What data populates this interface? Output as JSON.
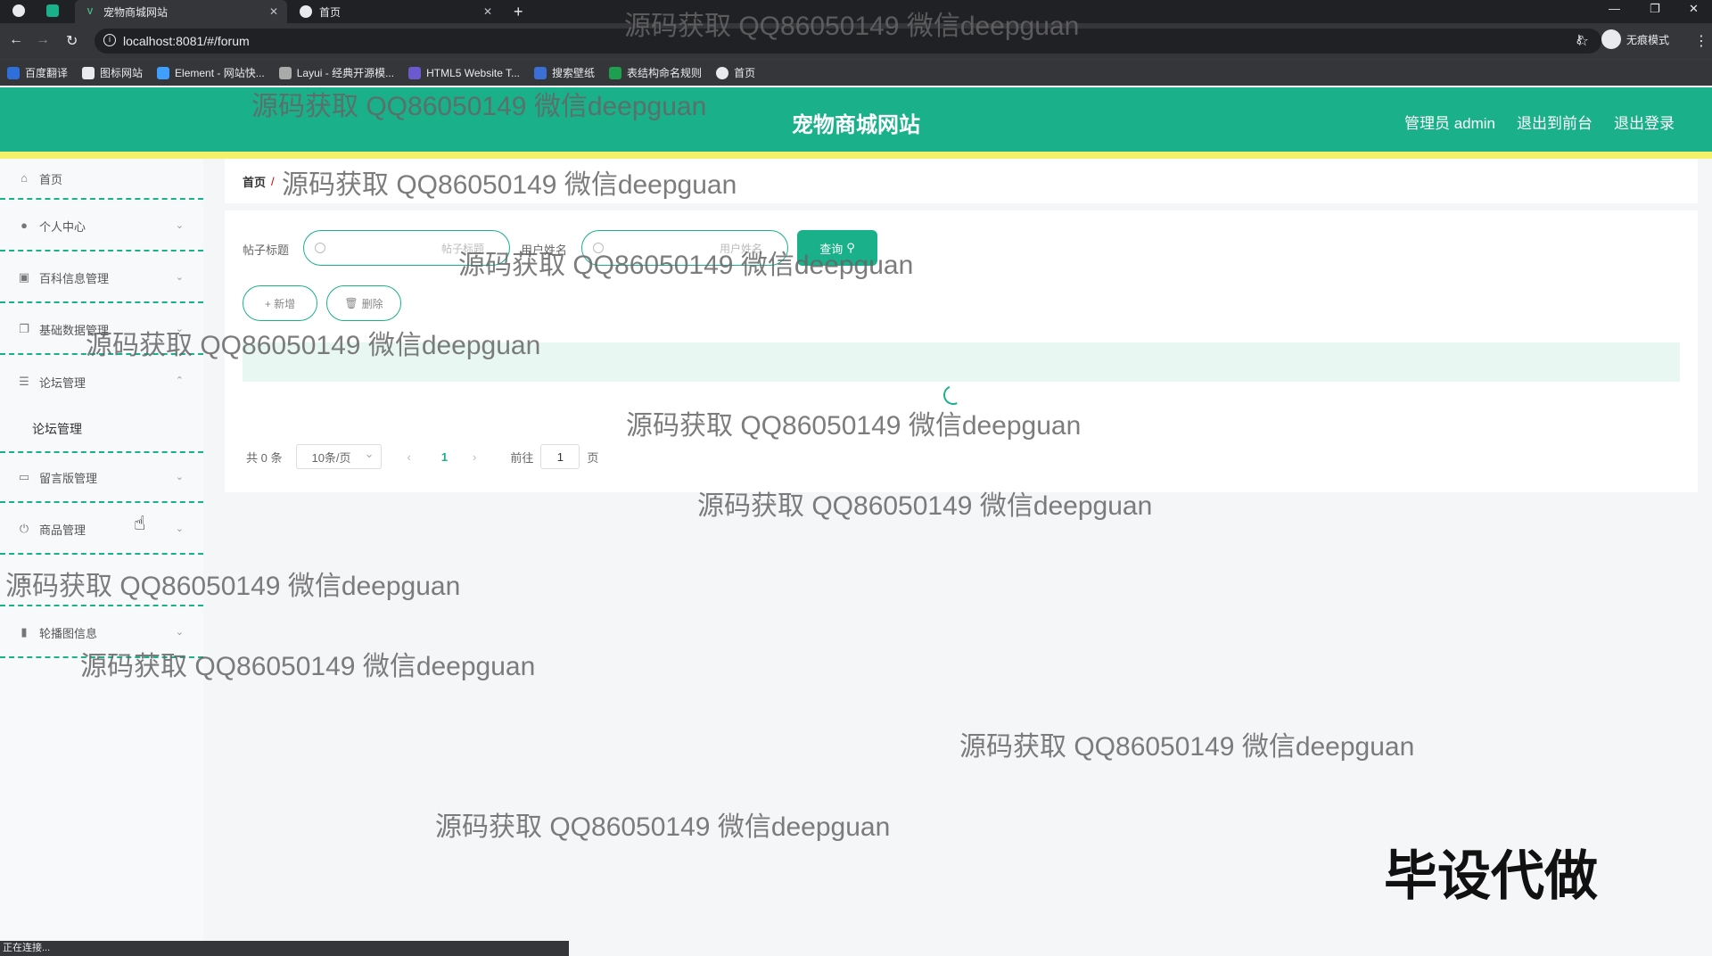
{
  "browser": {
    "tabs": [
      {
        "label": "宠物商城网站",
        "active": true
      },
      {
        "label": "首页",
        "active": false
      }
    ],
    "address": "localhost:8081/#/forum",
    "incognito_label": "无痕模式",
    "bookmarks": [
      "百度翻译",
      "图标网站",
      "Element - 网站快...",
      "Layui - 经典开源模...",
      "HTML5 Website T...",
      "搜索壁纸",
      "表结构命名规则",
      "首页"
    ],
    "status": "正在连接..."
  },
  "header": {
    "title": "宠物商城网站",
    "admin": "管理员 admin",
    "back_front": "退出到前台",
    "logout": "退出登录",
    "accent": "#1ab08a",
    "stripe": "#f3f06a"
  },
  "sidebar": {
    "items": [
      {
        "label": "首页",
        "icon": "home-icon"
      },
      {
        "label": "个人中心",
        "icon": "user-icon"
      },
      {
        "label": "百科信息管理",
        "icon": "clipboard-icon"
      },
      {
        "label": "基础数据管理",
        "icon": "copy-icon"
      },
      {
        "label": "论坛管理",
        "icon": "sliders-icon"
      },
      {
        "label": "留言版管理",
        "icon": "chat-icon"
      },
      {
        "label": "商品管理",
        "icon": "power-icon"
      },
      {
        "label": "",
        "icon": "box-icon"
      },
      {
        "label": "轮播图信息",
        "icon": "bar-chart-icon"
      }
    ],
    "submenu": "论坛管理"
  },
  "breadcrumb": {
    "home": "首页",
    "sep": "/"
  },
  "search": {
    "title_label": "帖子标题",
    "title_placeholder": "帖子标题",
    "user_label": "用户姓名",
    "user_placeholder": "用户姓名",
    "query_button": "查询"
  },
  "actions": {
    "add": "+ 新增",
    "delete": "删除"
  },
  "pager": {
    "total": "共 0 条",
    "size": "10条/页",
    "current": "1",
    "goto": "前往",
    "goto_value": "1",
    "page": "页"
  },
  "watermark": "源码获取 QQ86050149 微信deepguan",
  "stamp": "毕设代做"
}
